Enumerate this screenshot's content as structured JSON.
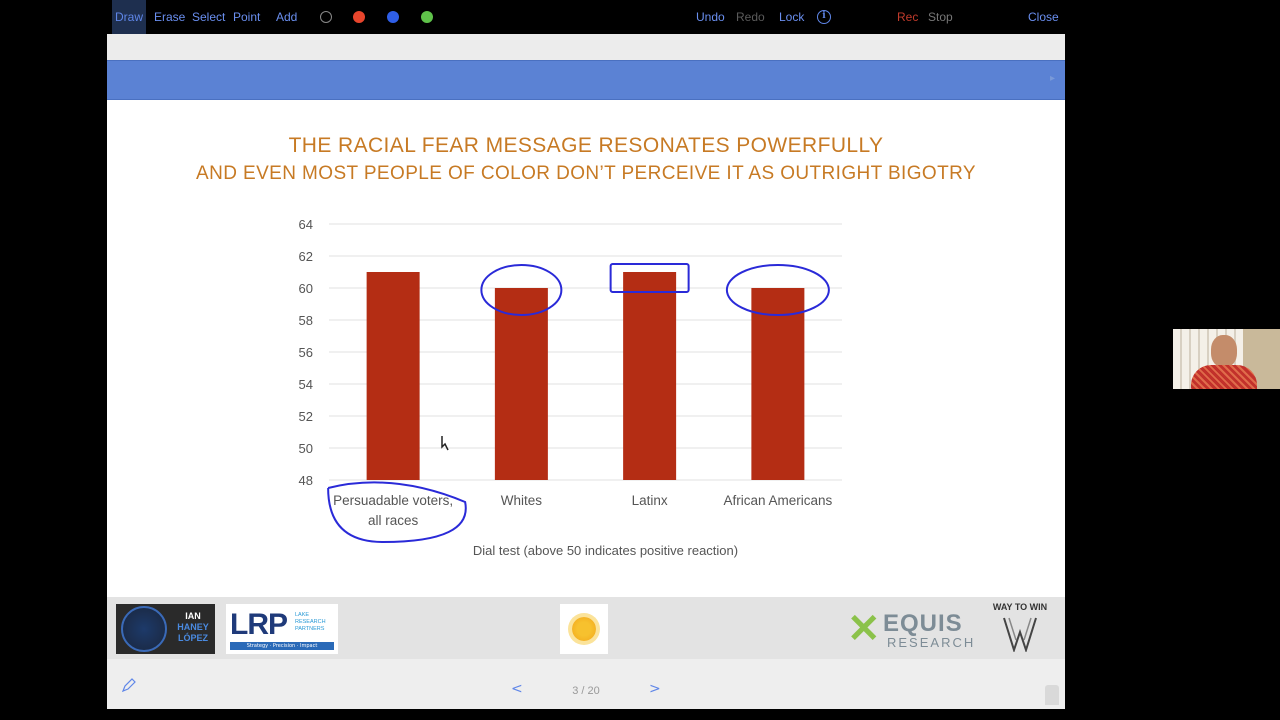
{
  "toolbar": {
    "draw": "Draw",
    "erase": "Erase",
    "select": "Select",
    "point": "Point",
    "add": "Add",
    "colors": [
      "#000000",
      "#e8452c",
      "#2f5fe8",
      "#5fc24a"
    ],
    "undo": "Undo",
    "redo": "Redo",
    "lock": "Lock",
    "rec": "Rec",
    "stop": "Stop",
    "close": "Close"
  },
  "slide": {
    "title_line1": "THE RACIAL FEAR MESSAGE RESONATES POWERFULLY",
    "title_line2": "AND EVEN MOST PEOPLE OF COLOR DON’T PERCEIVE IT AS OUTRIGHT BIGOTRY",
    "title_color": "#c77a24",
    "band_color": "#5b82d4"
  },
  "chart_data": {
    "type": "bar",
    "categories": [
      "Persuadable voters, all races",
      "Whites",
      "Latinx",
      "African Americans"
    ],
    "category_lines": [
      [
        "Persuadable voters,",
        "all races"
      ],
      [
        "Whites"
      ],
      [
        "Latinx"
      ],
      [
        "African Americans"
      ]
    ],
    "values": [
      61,
      60,
      61,
      60
    ],
    "ylim": [
      48,
      64
    ],
    "yticks": [
      48,
      50,
      52,
      54,
      56,
      58,
      60,
      62,
      64
    ],
    "xlabel": "Dial test (above 50 indicates positive reaction)",
    "ylabel": "",
    "bar_color": "#b42d14",
    "grid": true,
    "annotation_color": "#2a2ad8"
  },
  "footer": {
    "ihl_lines": [
      "IAN",
      "HANEY",
      "LÓPEZ"
    ],
    "lrp_big": "LRP",
    "lrp_small": "LAKE RESEARCH PARTNERS",
    "lrp_tag": "Strategy · Precision · Impact",
    "equis_top": "EQUIS",
    "equis_bottom": "RESEARCH",
    "w2w": "WAY TO WIN"
  },
  "nav": {
    "prev": "<",
    "next": ">",
    "page": "3 / 20"
  }
}
